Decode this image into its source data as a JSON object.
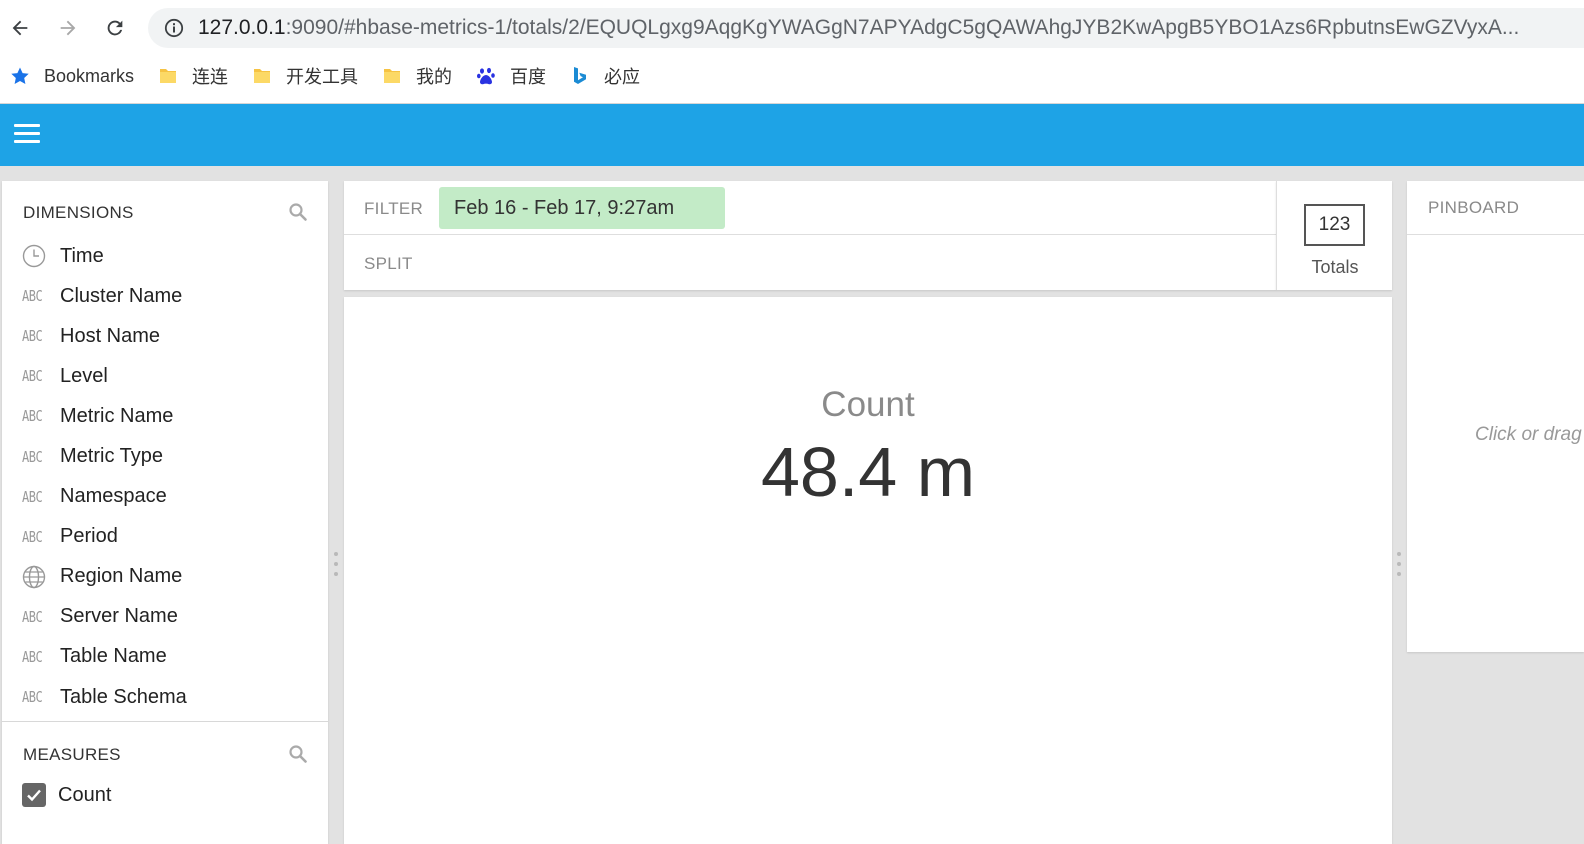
{
  "browser": {
    "url_host": "127.0.0.1",
    "url_rest": ":9090/#hbase-metrics-1/totals/2/EQUQLgxg9AqgKgYWAGgN7APYAdgC5gQAWAhgJYB2KwApgB5YBO1Azs6RpbutnsEwGZVyxA...",
    "bookmarks": [
      {
        "label": "Bookmarks",
        "icon": "star-icon"
      },
      {
        "label": "连连",
        "icon": "folder-icon"
      },
      {
        "label": "开发工具",
        "icon": "folder-icon"
      },
      {
        "label": "我的",
        "icon": "folder-icon"
      },
      {
        "label": "百度",
        "icon": "baidu-paw-icon"
      },
      {
        "label": "必应",
        "icon": "bing-icon"
      }
    ]
  },
  "dimensions": {
    "title": "DIMENSIONS",
    "items": [
      {
        "label": "Time",
        "icon": "clock-icon"
      },
      {
        "label": "Cluster Name",
        "icon": "abc-icon"
      },
      {
        "label": "Host Name",
        "icon": "abc-icon"
      },
      {
        "label": "Level",
        "icon": "abc-icon"
      },
      {
        "label": "Metric Name",
        "icon": "abc-icon"
      },
      {
        "label": "Metric Type",
        "icon": "abc-icon"
      },
      {
        "label": "Namespace",
        "icon": "abc-icon"
      },
      {
        "label": "Period",
        "icon": "abc-icon"
      },
      {
        "label": "Region Name",
        "icon": "globe-icon"
      },
      {
        "label": "Server Name",
        "icon": "abc-icon"
      },
      {
        "label": "Table Name",
        "icon": "abc-icon"
      },
      {
        "label": "Table Schema",
        "icon": "abc-icon"
      }
    ],
    "abc_glyph": "ABC"
  },
  "measures": {
    "title": "MEASURES",
    "items": [
      {
        "label": "Count",
        "checked": true
      }
    ]
  },
  "filter": {
    "label": "FILTER",
    "tile": "Feb 16 - Feb 17, 9:27am"
  },
  "split": {
    "label": "SPLIT"
  },
  "visualization": {
    "icon_text": "123",
    "label": "Totals"
  },
  "totals": {
    "measure": "Count",
    "value": "48.4 m"
  },
  "pinboard": {
    "title": "PINBOARD",
    "hint": "Click or drag dimensions to pin them"
  },
  "colors": {
    "header": "#1ea3e6",
    "filter_tile": "#c3ebc7"
  }
}
